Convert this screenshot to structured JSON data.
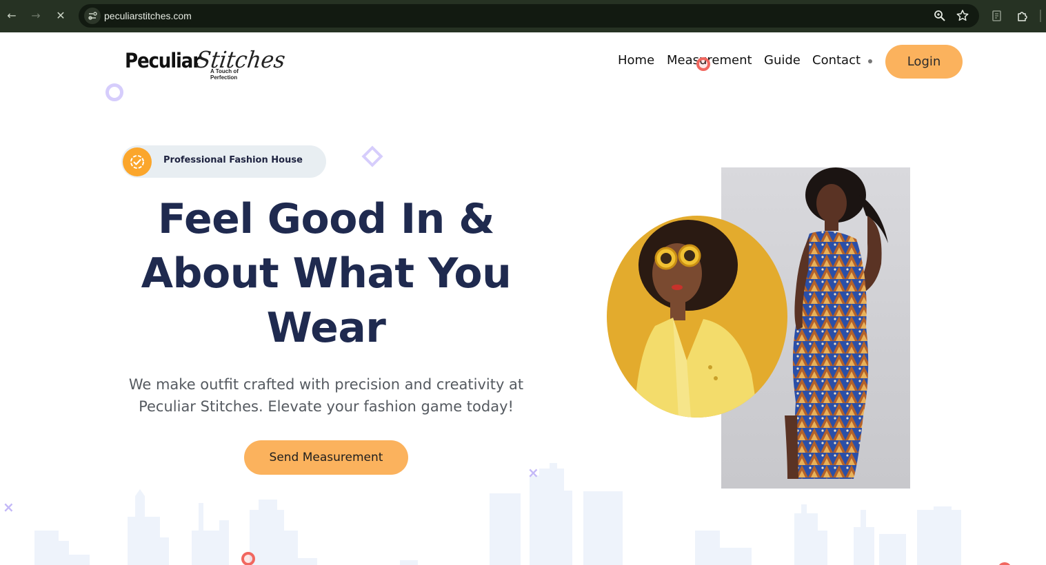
{
  "browser": {
    "url": "peculiarstitches.com",
    "back_icon": "arrow-left-icon",
    "forward_icon": "arrow-right-icon",
    "stop_icon": "close-icon"
  },
  "header": {
    "logo": {
      "bold": "Peculiar",
      "script": "Stitches",
      "tagline": "A Touch of Perfection"
    },
    "nav": [
      "Home",
      "Measurement",
      "Guide",
      "Contact"
    ],
    "login_label": "Login"
  },
  "hero": {
    "badge_label": "Professional Fashion House",
    "headline_lines": [
      "Feel Good In &",
      "About What You",
      "Wear"
    ],
    "subtext_lines": [
      "We make outfit crafted with precision and creativity at",
      "Peculiar Stitches. Elevate your fashion game today!"
    ],
    "cta_label": "Send Measurement"
  },
  "colors": {
    "accent": "#fbb25d",
    "heading": "#1f2a4f",
    "badge_bg": "#e8eef2",
    "badge_icon": "#fba62c",
    "circle_photo_bg": "#e3ab2d",
    "skyline": "#eef3fb",
    "decor_purple": "#d6cdfc"
  }
}
